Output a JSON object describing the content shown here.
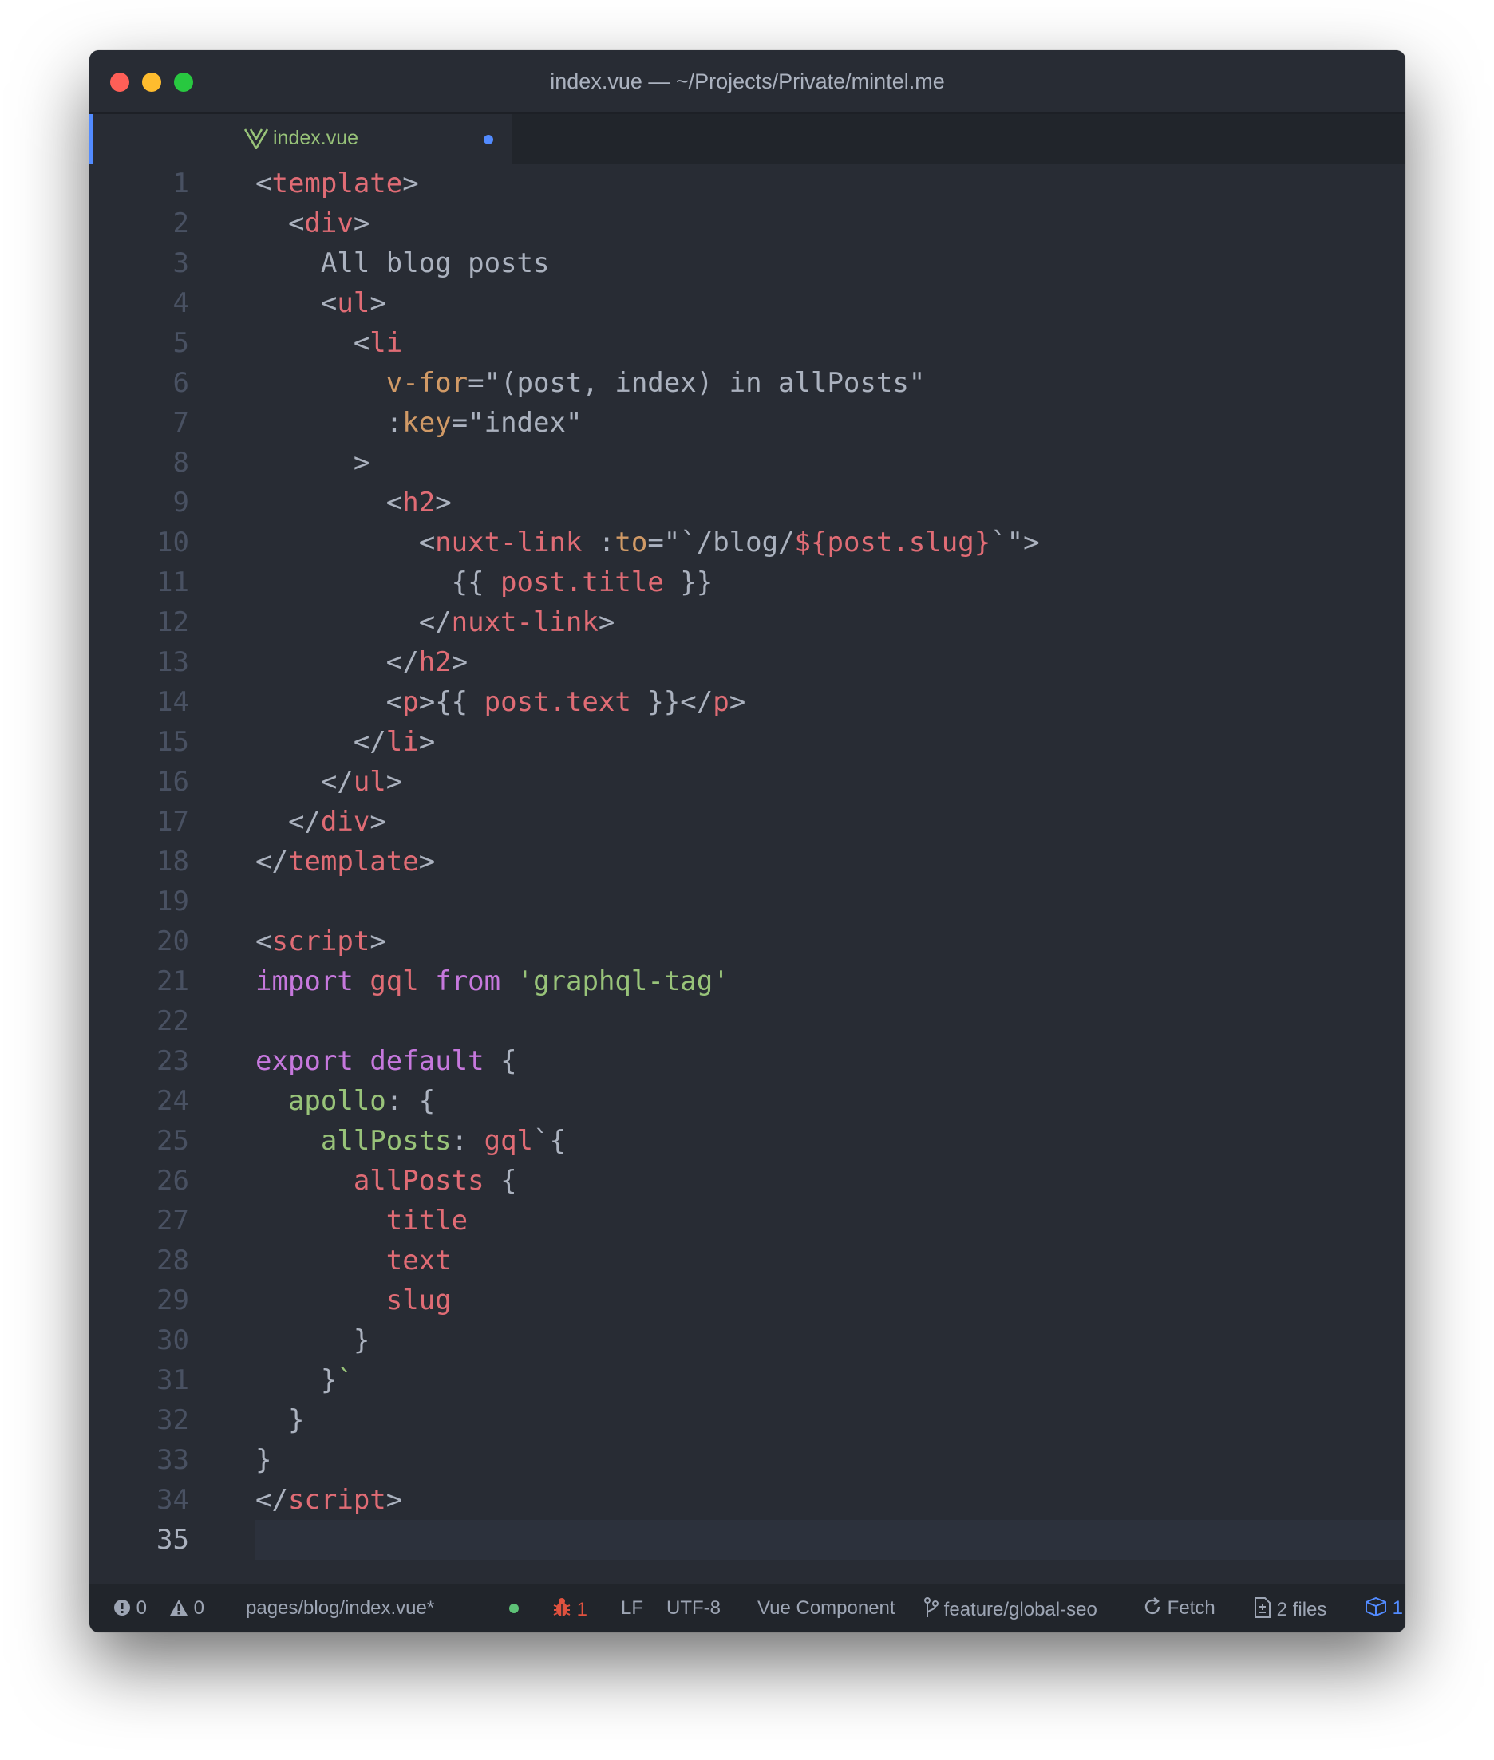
{
  "window": {
    "title": "index.vue — ~/Projects/Private/mintel.me"
  },
  "tab": {
    "label": "index.vue",
    "icon": "vue-icon",
    "modified": true
  },
  "editor": {
    "lines": [
      [
        [
          "<",
          "p"
        ],
        [
          "template",
          "tag"
        ],
        [
          ">",
          "p"
        ]
      ],
      [
        [
          "  <",
          "p"
        ],
        [
          "div",
          "tag"
        ],
        [
          ">",
          "p"
        ]
      ],
      [
        [
          "    All blog posts",
          "p"
        ]
      ],
      [
        [
          "    <",
          "p"
        ],
        [
          "ul",
          "tag"
        ],
        [
          ">",
          "p"
        ]
      ],
      [
        [
          "      <",
          "p"
        ],
        [
          "li",
          "tag"
        ]
      ],
      [
        [
          "        ",
          "p"
        ],
        [
          "v-for",
          "attr"
        ],
        [
          "=\"(post, index) in allPosts\"",
          "p"
        ]
      ],
      [
        [
          "        :",
          "p"
        ],
        [
          "key",
          "attr"
        ],
        [
          "=\"index\"",
          "p"
        ]
      ],
      [
        [
          "      >",
          "p"
        ]
      ],
      [
        [
          "        <",
          "p"
        ],
        [
          "h2",
          "tag"
        ],
        [
          ">",
          "p"
        ]
      ],
      [
        [
          "          <",
          "p"
        ],
        [
          "nuxt-link",
          "tag"
        ],
        [
          " :",
          "p"
        ],
        [
          "to",
          "attr"
        ],
        [
          "=\"`/blog/",
          "p"
        ],
        [
          "${post.slug}",
          "var"
        ],
        [
          "`\">",
          "p"
        ]
      ],
      [
        [
          "            {{ ",
          "p"
        ],
        [
          "post.title",
          "var"
        ],
        [
          " }}",
          "p"
        ]
      ],
      [
        [
          "          </",
          "p"
        ],
        [
          "nuxt-link",
          "tag"
        ],
        [
          ">",
          "p"
        ]
      ],
      [
        [
          "        </",
          "p"
        ],
        [
          "h2",
          "tag"
        ],
        [
          ">",
          "p"
        ]
      ],
      [
        [
          "        <",
          "p"
        ],
        [
          "p",
          "tag"
        ],
        [
          ">{{ ",
          "p"
        ],
        [
          "post.text",
          "var"
        ],
        [
          " }}</",
          "p"
        ],
        [
          "p",
          "tag"
        ],
        [
          ">",
          "p"
        ]
      ],
      [
        [
          "      </",
          "p"
        ],
        [
          "li",
          "tag"
        ],
        [
          ">",
          "p"
        ]
      ],
      [
        [
          "    </",
          "p"
        ],
        [
          "ul",
          "tag"
        ],
        [
          ">",
          "p"
        ]
      ],
      [
        [
          "  </",
          "p"
        ],
        [
          "div",
          "tag"
        ],
        [
          ">",
          "p"
        ]
      ],
      [
        [
          "</",
          "p"
        ],
        [
          "template",
          "tag"
        ],
        [
          ">",
          "p"
        ]
      ],
      [],
      [
        [
          "<",
          "p"
        ],
        [
          "script",
          "tag"
        ],
        [
          ">",
          "p"
        ]
      ],
      [
        [
          "import",
          "kw"
        ],
        [
          " ",
          "p"
        ],
        [
          "gql",
          "var"
        ],
        [
          " ",
          "p"
        ],
        [
          "from",
          "kw"
        ],
        [
          " ",
          "p"
        ],
        [
          "'graphql-tag'",
          "str"
        ]
      ],
      [],
      [
        [
          "export",
          "kw"
        ],
        [
          " ",
          "p"
        ],
        [
          "default",
          "kw"
        ],
        [
          " {",
          "p"
        ]
      ],
      [
        [
          "  ",
          "p"
        ],
        [
          "apollo",
          "prop"
        ],
        [
          ": {",
          "p"
        ]
      ],
      [
        [
          "    ",
          "p"
        ],
        [
          "allPosts",
          "prop"
        ],
        [
          ": ",
          "p"
        ],
        [
          "gql",
          "var"
        ],
        [
          "`{",
          "p"
        ]
      ],
      [
        [
          "      ",
          "p"
        ],
        [
          "allPosts",
          "var"
        ],
        [
          " {",
          "p"
        ]
      ],
      [
        [
          "        ",
          "p"
        ],
        [
          "title",
          "var"
        ]
      ],
      [
        [
          "        ",
          "p"
        ],
        [
          "text",
          "var"
        ]
      ],
      [
        [
          "        ",
          "p"
        ],
        [
          "slug",
          "var"
        ]
      ],
      [
        [
          "      }",
          "p"
        ]
      ],
      [
        [
          "    }",
          "p"
        ],
        [
          "`",
          "str"
        ]
      ],
      [
        [
          "  }",
          "p"
        ]
      ],
      [
        [
          "}",
          "p"
        ]
      ],
      [
        [
          "</",
          "p"
        ],
        [
          "script",
          "tag"
        ],
        [
          ">",
          "p"
        ]
      ],
      []
    ],
    "active_line": 35
  },
  "statusbar": {
    "errors": "0",
    "warnings": "0",
    "file_path": "pages/blog/index.vue*",
    "linter_count": "1",
    "line_ending": "LF",
    "encoding": "UTF-8",
    "grammar": "Vue Component",
    "branch": "feature/global-seo",
    "fetch": "Fetch",
    "changed_files": "2 files",
    "packages": "1"
  },
  "colors": {
    "background": "#282c34",
    "tag": "#e06c75",
    "attr": "#d19a66",
    "string": "#98c379",
    "keyword": "#c678dd",
    "accent": "#528bff"
  }
}
